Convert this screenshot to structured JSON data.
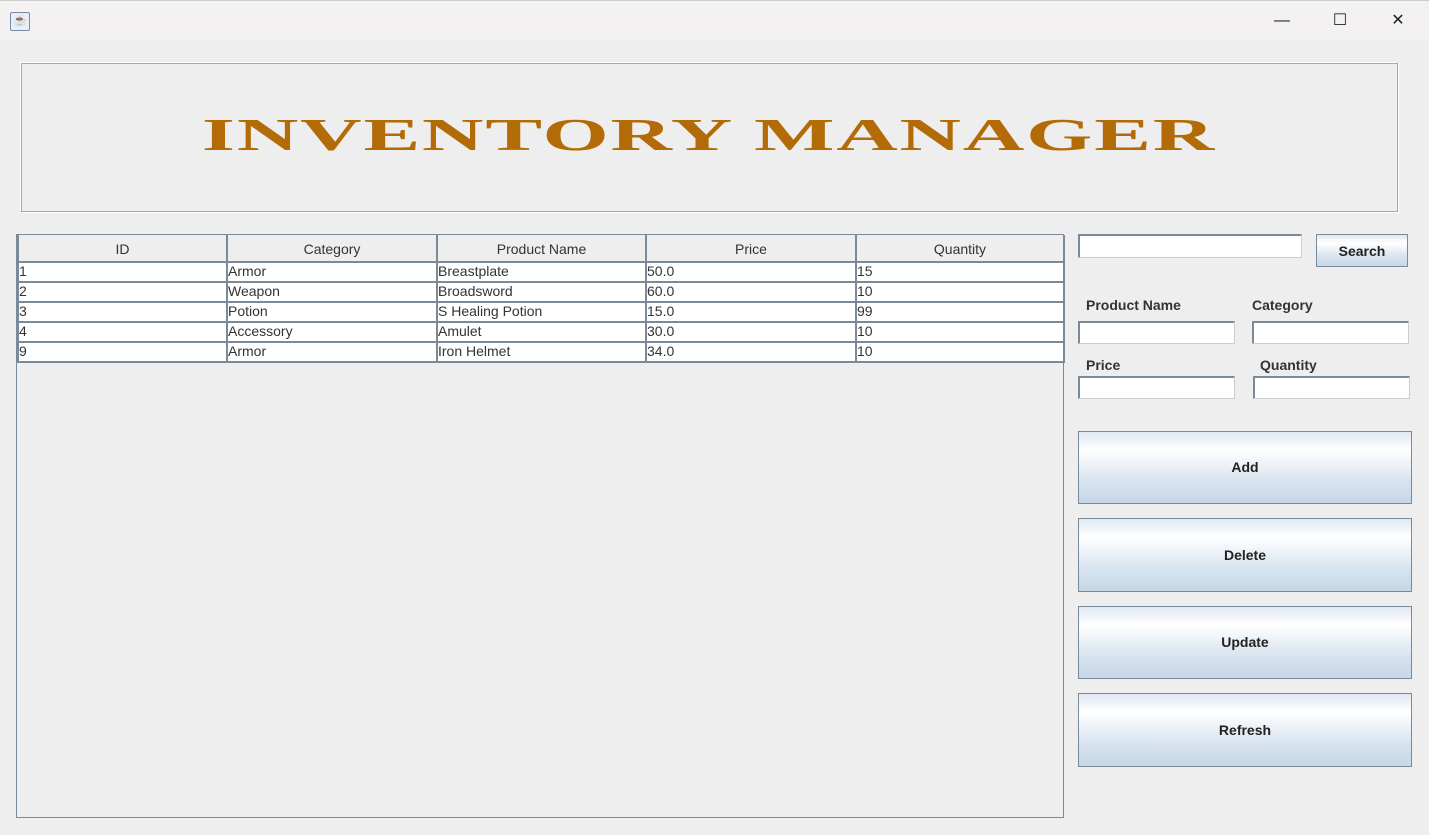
{
  "window": {
    "minimize": "—",
    "maximize": "☐",
    "close": "✕"
  },
  "banner": {
    "title": "INVENTORY MANAGER"
  },
  "table": {
    "columns": [
      "ID",
      "Category",
      "Product Name",
      "Price",
      "Quantity"
    ],
    "rows": [
      [
        "1",
        "Armor",
        "Breastplate",
        "50.0",
        "15"
      ],
      [
        "2",
        "Weapon",
        "Broadsword",
        "60.0",
        "10"
      ],
      [
        "3",
        "Potion",
        "S Healing Potion",
        "15.0",
        "99"
      ],
      [
        "4",
        "Accessory",
        "Amulet",
        "30.0",
        "10"
      ],
      [
        "9",
        "Armor",
        "Iron Helmet",
        "34.0",
        "10"
      ]
    ]
  },
  "search": {
    "value": "",
    "button": "Search"
  },
  "form": {
    "product_name_label": "Product Name",
    "category_label": "Category",
    "price_label": "Price",
    "quantity_label": "Quantity"
  },
  "actions": {
    "add": "Add",
    "delete": "Delete",
    "update": "Update",
    "refresh": "Refresh"
  }
}
